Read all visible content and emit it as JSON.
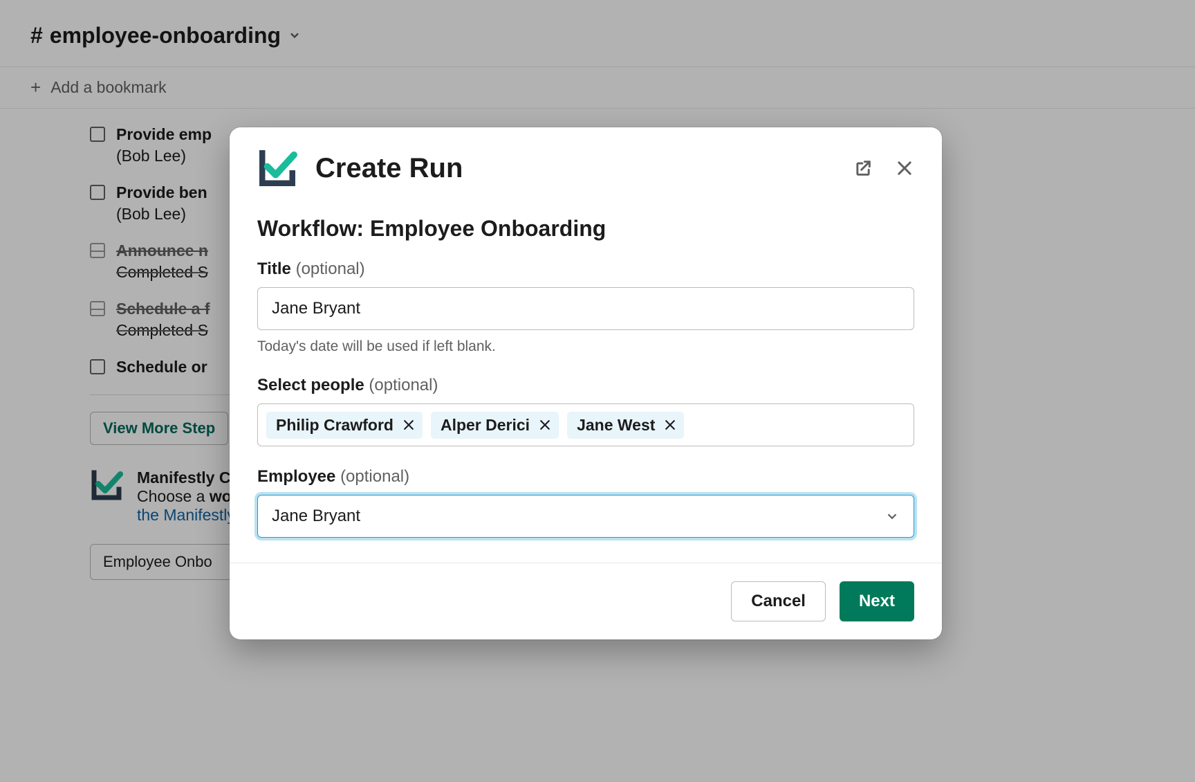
{
  "channel": {
    "name": "employee-onboarding",
    "bookmark_prompt": "Add a bookmark"
  },
  "tasks": [
    {
      "title": "Provide emp",
      "sub": "(Bob Lee)",
      "done": false
    },
    {
      "title": "Provide ben",
      "sub": "(Bob Lee)",
      "done": false
    },
    {
      "title": "Announce n",
      "sub": "Completed S",
      "done": true
    },
    {
      "title": "Schedule a f",
      "sub": "Completed S",
      "done": true
    },
    {
      "title": "Schedule or",
      "sub": "",
      "done": false
    }
  ],
  "view_more": "View More Step",
  "app": {
    "name": "Manifestly Che",
    "line2_pre": "Choose a ",
    "line2_bold": "work",
    "line3": "the Manifestly"
  },
  "dropdown_bg": "Employee Onbo",
  "modal": {
    "title": "Create Run",
    "subtitle": "Workflow: Employee Onboarding",
    "fields": {
      "title": {
        "label": "Title",
        "optional": "(optional)",
        "value": "Jane Bryant",
        "helper": "Today's date will be used if left blank."
      },
      "people": {
        "label": "Select people",
        "optional": "(optional)",
        "chips": [
          "Philip Crawford",
          "Alper Derici",
          "Jane West"
        ]
      },
      "employee": {
        "label": "Employee",
        "optional": "(optional)",
        "value": "Jane Bryant"
      }
    },
    "buttons": {
      "cancel": "Cancel",
      "next": "Next"
    }
  }
}
